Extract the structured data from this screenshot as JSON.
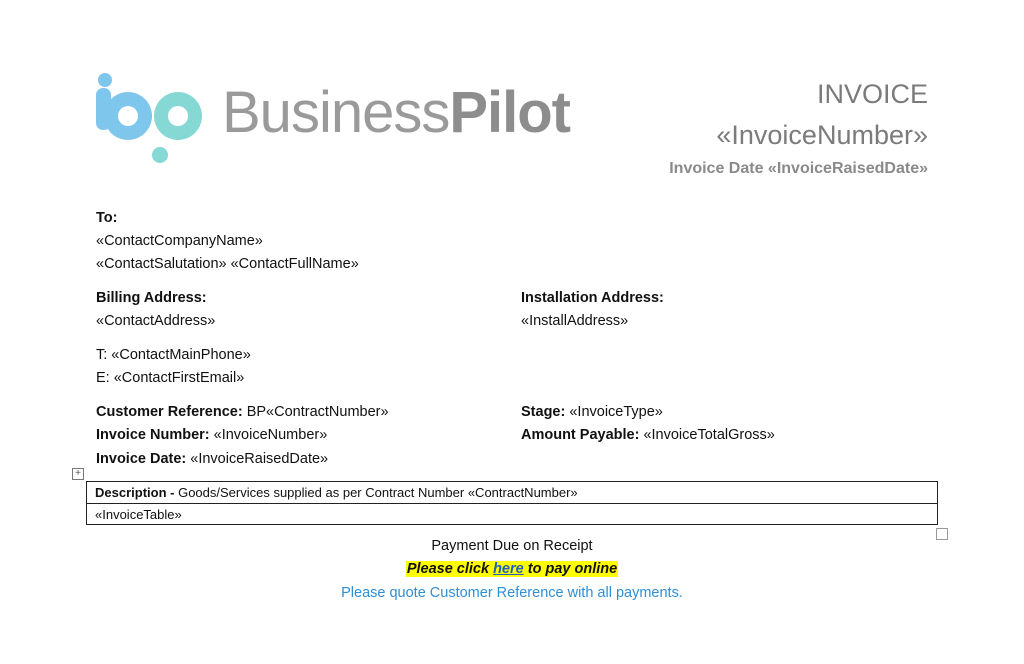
{
  "brand": {
    "name_light": "Business",
    "name_bold": "Pilot",
    "mark_colors": {
      "blue": "#7fc6ec",
      "teal": "#86d8d4"
    }
  },
  "header": {
    "title": "INVOICE",
    "number_field": "«InvoiceNumber»",
    "date_line": "Invoice Date «InvoiceRaisedDate»"
  },
  "to": {
    "label": "To:",
    "company": "«ContactCompanyName»",
    "salutation_name": "«ContactSalutation» «ContactFullName»"
  },
  "billing": {
    "label": "Billing Address:",
    "value": "«ContactAddress»"
  },
  "installation": {
    "label": "Installation Address:",
    "value": "«InstallAddress»"
  },
  "contact": {
    "phone": "T: «ContactMainPhone»",
    "email": "E: «ContactFirstEmail»"
  },
  "details": {
    "customer_ref_label": "Customer Reference:",
    "customer_ref_value": " BP«ContractNumber»",
    "invoice_number_label": "Invoice Number:",
    "invoice_number_value": " «InvoiceNumber»",
    "invoice_date_label": "Invoice Date:",
    "invoice_date_value": " «InvoiceRaisedDate»",
    "stage_label": "Stage:",
    "stage_value": " «InvoiceType»",
    "amount_label": "Amount Payable:",
    "amount_value": " «InvoiceTotalGross»"
  },
  "table": {
    "description_label": "Description -",
    "description_text": " Goods/Services supplied as per Contract Number «ContractNumber»",
    "row2": "«InvoiceTable»"
  },
  "footer": {
    "payment_due": "Payment Due on Receipt",
    "click_prefix": "Please click ",
    "click_link": "here",
    "click_suffix": " to pay online",
    "quote_note": "Please quote Customer Reference with all payments."
  },
  "colors": {
    "highlight": "#ffff00",
    "link": "#1f5fbf",
    "note": "#2d8fd6"
  }
}
